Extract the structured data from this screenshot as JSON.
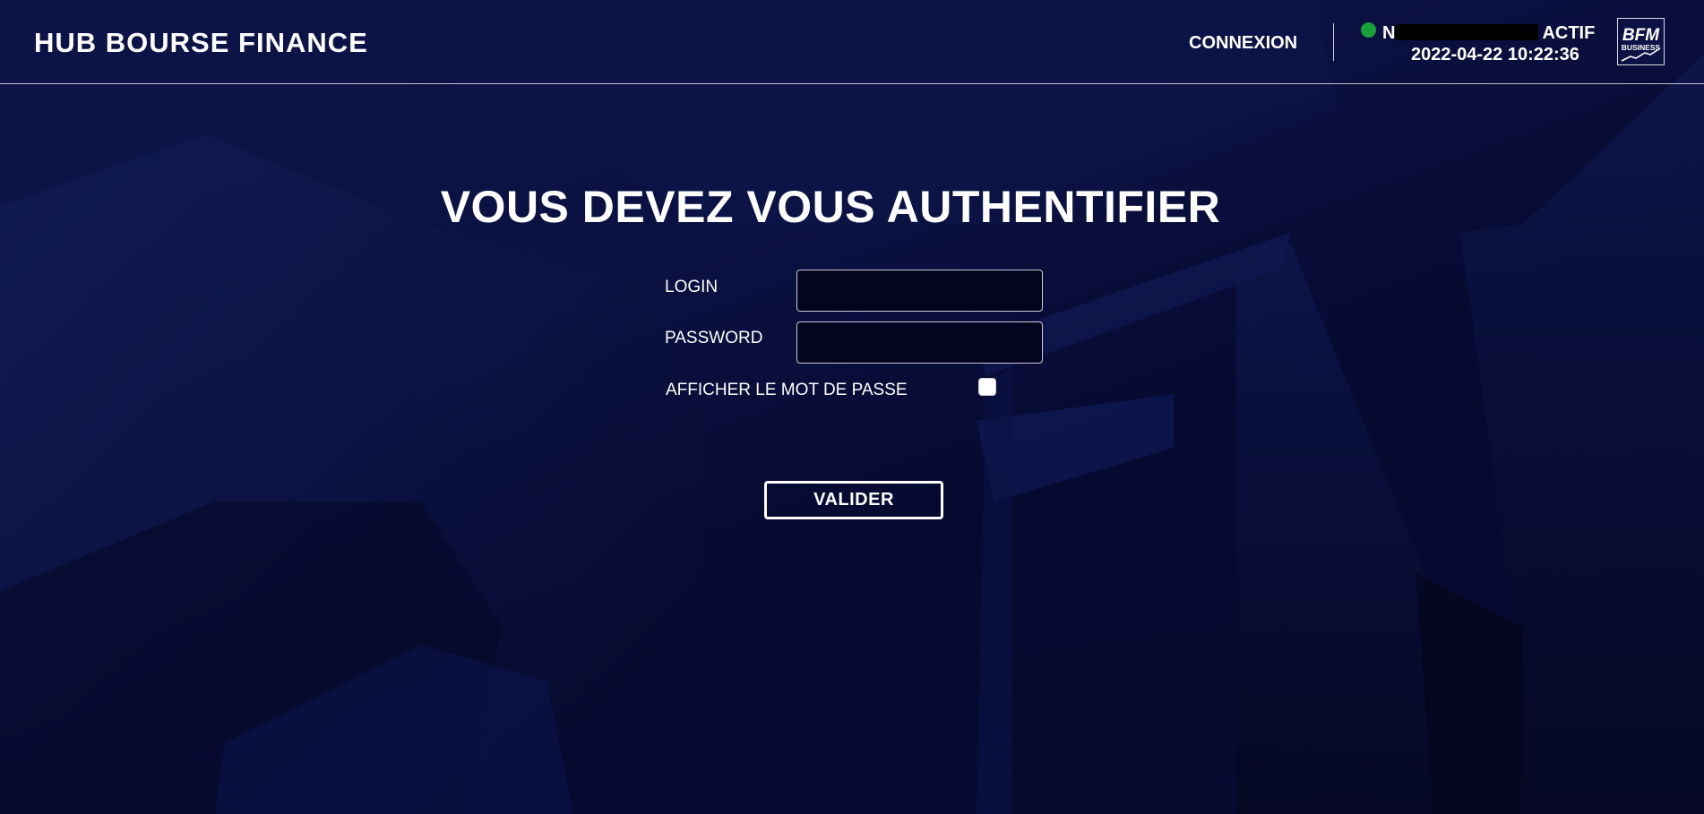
{
  "header": {
    "brand": "HUB BOURSE FINANCE",
    "nav_connexion": "CONNEXION",
    "status": {
      "initial": "N",
      "state": "ACTIF",
      "dot_color": "#19a13a"
    },
    "datetime": "2022-04-22 10:22:36",
    "logo": {
      "line1": "BFM",
      "line2": "BUSINESS"
    }
  },
  "main": {
    "title": "VOUS DEVEZ VOUS AUTHENTIFIER",
    "login_label": "LOGIN",
    "login_value": "",
    "password_label": "PASSWORD",
    "password_value": "",
    "show_password_label": "AFFICHER LE MOT DE PASSE",
    "show_password_checked": false,
    "submit_label": "VALIDER"
  },
  "colors": {
    "background": "#0a0f3a",
    "text": "#ffffff",
    "status_ok": "#19a13a"
  }
}
